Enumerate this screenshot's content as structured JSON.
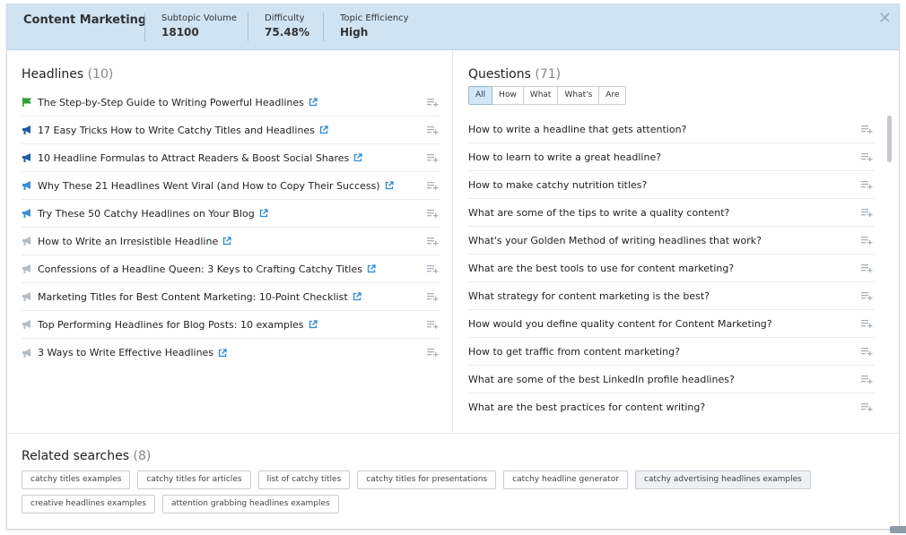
{
  "header": {
    "topic": "Content Marketing",
    "stats": [
      {
        "label": "Subtopic Volume",
        "value": "18100"
      },
      {
        "label": "Difficulty",
        "value": "75.48%"
      },
      {
        "label": "Topic Efficiency",
        "value": "High"
      }
    ],
    "close_glyph": "✕"
  },
  "headlines": {
    "title": "Headlines",
    "count": "(10)",
    "items": [
      {
        "text": "The Step-by-Step Guide to Writing Powerful Headlines",
        "icon": "promo-green"
      },
      {
        "text": "17 Easy Tricks How to Write Catchy Titles and Headlines",
        "icon": "promo-blue-dark"
      },
      {
        "text": "10 Headline Formulas to Attract Readers & Boost Social Shares",
        "icon": "promo-blue-dark"
      },
      {
        "text": "Why These 21 Headlines Went Viral (and How to Copy Their Success)",
        "icon": "promo-blue"
      },
      {
        "text": "Try These 50 Catchy Headlines on Your Blog",
        "icon": "promo-blue"
      },
      {
        "text": "How to Write an Irresistible Headline",
        "icon": "promo-gray"
      },
      {
        "text": "Confessions of a Headline Queen: 3 Keys to Crafting Catchy Titles",
        "icon": "promo-gray"
      },
      {
        "text": "Marketing Titles for Best Content Marketing: 10-Point Checklist",
        "icon": "promo-gray"
      },
      {
        "text": "Top Performing Headlines for Blog Posts: 10 examples",
        "icon": "promo-gray"
      },
      {
        "text": "3 Ways to Write Effective Headlines",
        "icon": "promo-gray"
      }
    ]
  },
  "questions": {
    "title": "Questions",
    "count": "(71)",
    "filters": [
      "All",
      "How",
      "What",
      "What's",
      "Are"
    ],
    "active_filter": "All",
    "items": [
      "How to write a headline that gets attention?",
      "How to learn to write a great headline?",
      "How to make catchy nutrition titles?",
      "What are some of the tips to write a quality content?",
      "What's your Golden Method of writing headlines that work?",
      "What are the best tools to use for content marketing?",
      "What strategy for content marketing is the best?",
      "How would you define quality content for Content Marketing?",
      "How to get traffic from content marketing?",
      "What are some of the best LinkedIn profile headlines?",
      "What are the best practices for content writing?"
    ]
  },
  "related": {
    "title": "Related searches",
    "count": "(8)",
    "tags_row1": [
      "catchy titles examples",
      "catchy titles for articles",
      "list of catchy titles",
      "catchy titles for presentations",
      "catchy headline generator",
      "catchy advertising headlines examples"
    ],
    "tags_row2": [
      "creative headlines examples",
      "attention grabbing headlines examples"
    ]
  },
  "colors": {
    "header_bg": "#cfe3f3",
    "active_filter_bg": "#d4e7f7",
    "icon_green": "#2e9d3a",
    "icon_blue_dark": "#1e5f9e",
    "icon_blue": "#3d8fd1",
    "icon_gray": "#b5bcc3",
    "link_icon": "#2b8ad6"
  }
}
